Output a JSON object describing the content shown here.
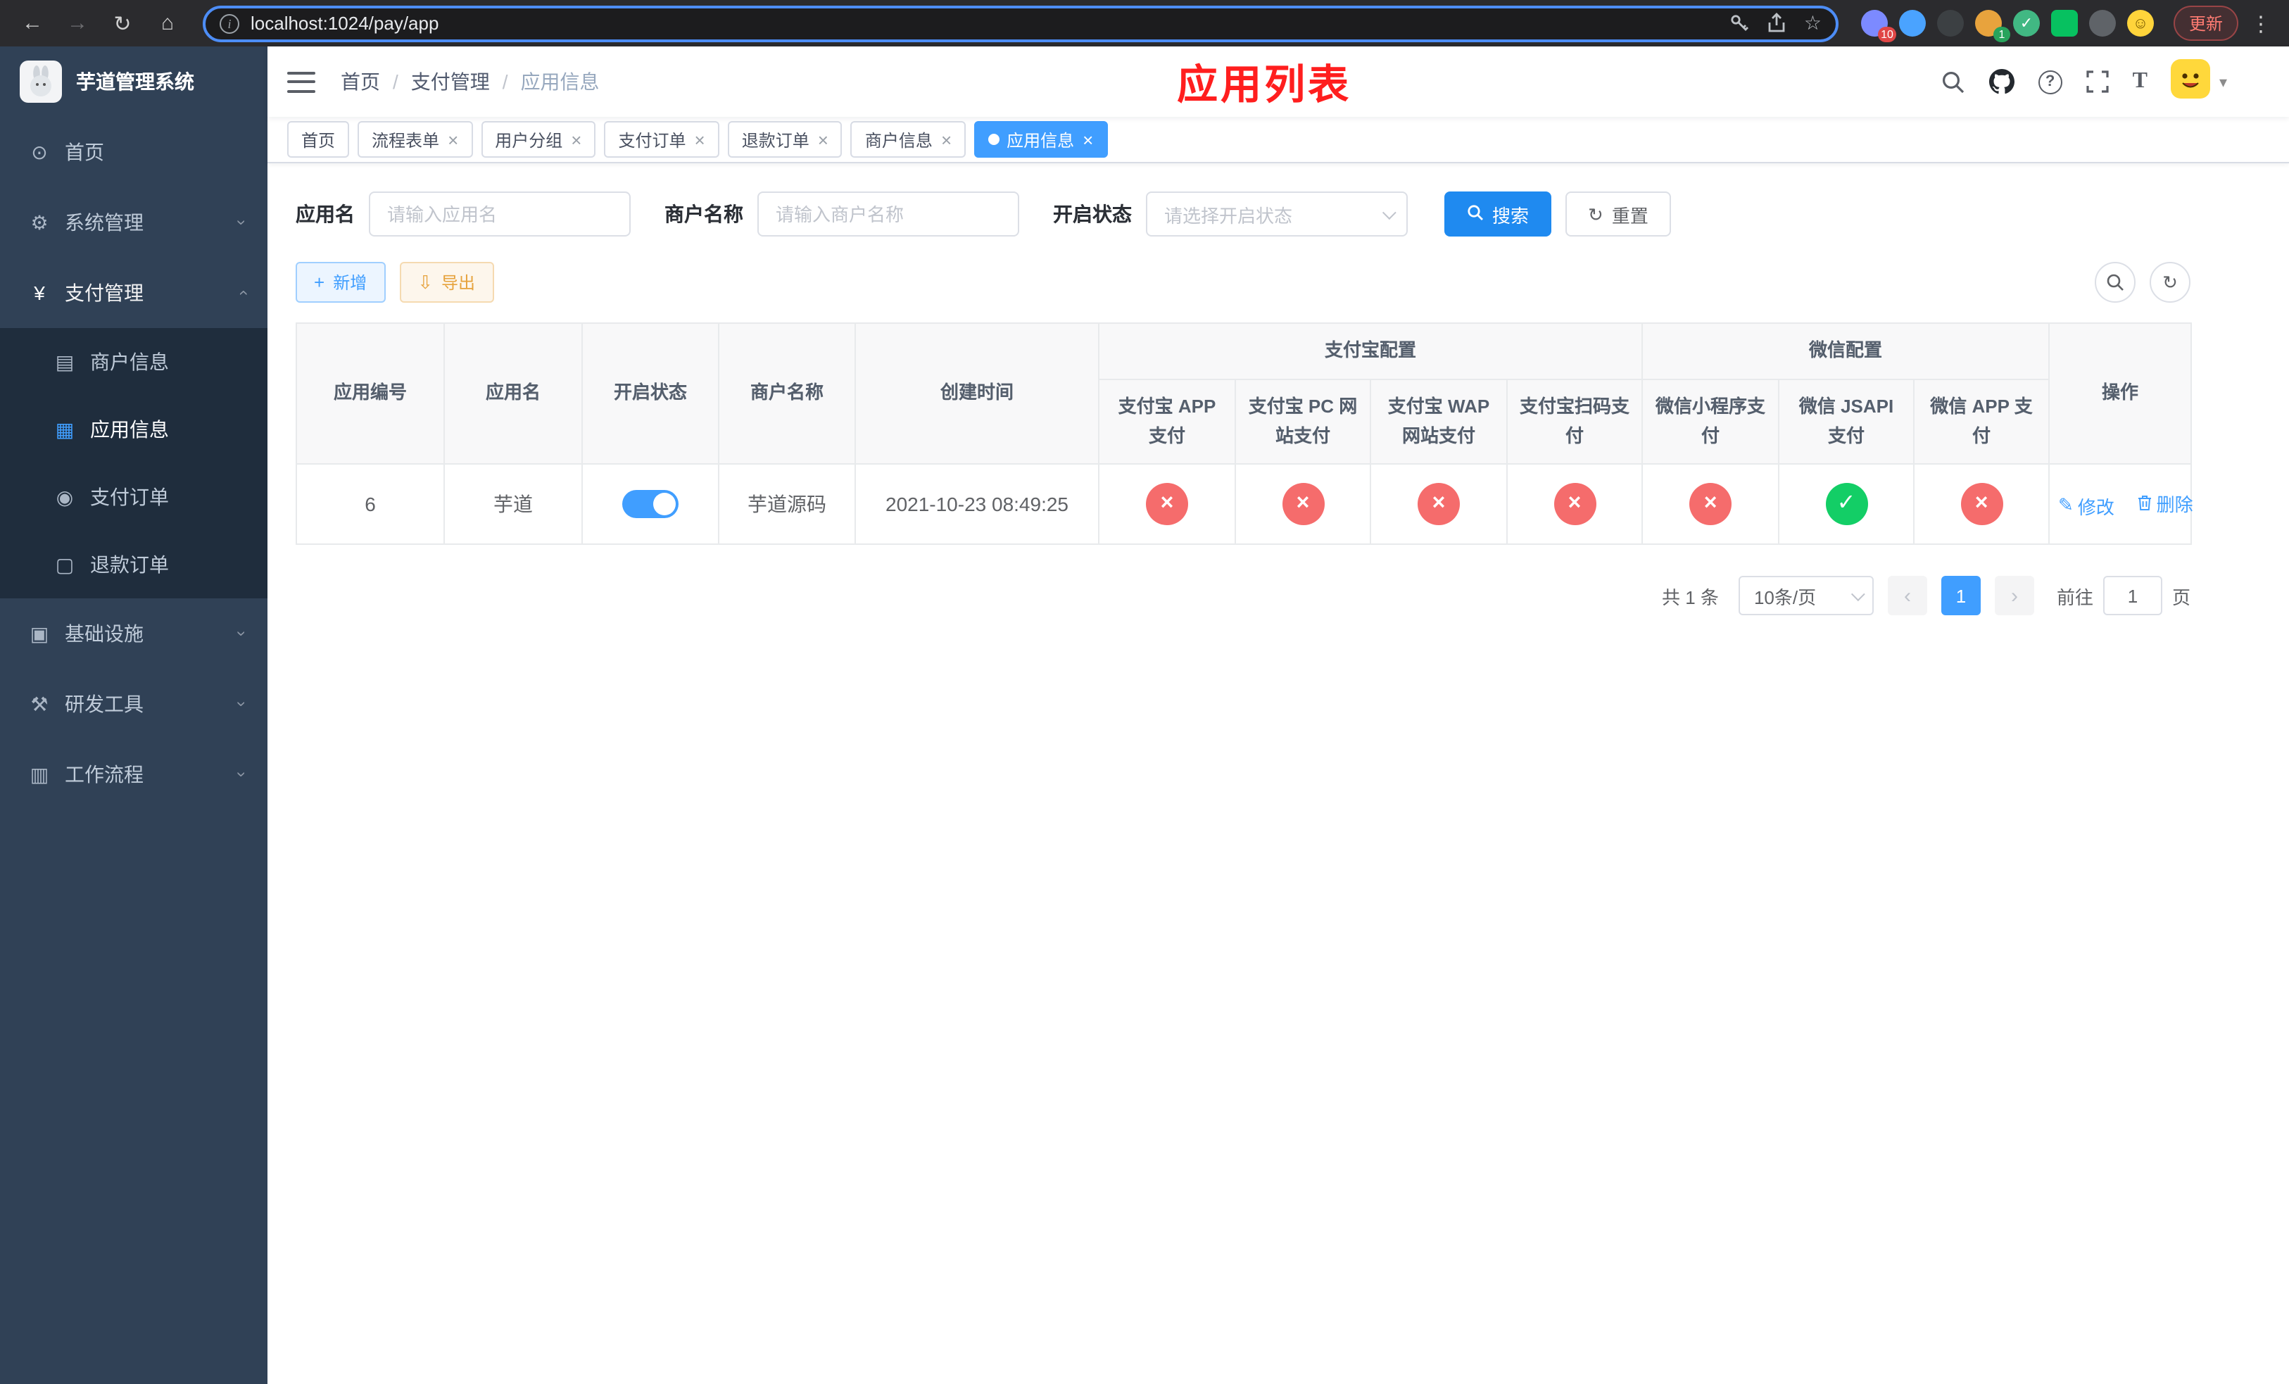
{
  "browser": {
    "url": "localhost:1024/pay/app",
    "update_label": "更新",
    "extension_badge_puzzle": "10",
    "extension_badge_avatar": "1"
  },
  "sidebar": {
    "title": "芋道管理系统",
    "items": [
      {
        "label": "首页"
      },
      {
        "label": "系统管理"
      },
      {
        "label": "支付管理"
      },
      {
        "label": "商户信息"
      },
      {
        "label": "应用信息"
      },
      {
        "label": "支付订单"
      },
      {
        "label": "退款订单"
      },
      {
        "label": "基础设施"
      },
      {
        "label": "研发工具"
      },
      {
        "label": "工作流程"
      }
    ]
  },
  "breadcrumb": [
    "首页",
    "支付管理",
    "应用信息"
  ],
  "header": {
    "page_title": "应用列表"
  },
  "tabs": [
    {
      "label": "首页"
    },
    {
      "label": "流程表单"
    },
    {
      "label": "用户分组"
    },
    {
      "label": "支付订单"
    },
    {
      "label": "退款订单"
    },
    {
      "label": "商户信息"
    },
    {
      "label": "应用信息"
    }
  ],
  "filters": {
    "app_name_label": "应用名",
    "app_name_placeholder": "请输入应用名",
    "merchant_label": "商户名称",
    "merchant_placeholder": "请输入商户名称",
    "status_label": "开启状态",
    "status_placeholder": "请选择开启状态",
    "search_label": "搜索",
    "reset_label": "重置"
  },
  "toolbar": {
    "add_label": "新增",
    "export_label": "导出"
  },
  "table": {
    "main_columns": [
      "应用编号",
      "应用名",
      "开启状态",
      "商户名称",
      "创建时间"
    ],
    "alipay_group": "支付宝配置",
    "wechat_group": "微信配置",
    "ops_column": "操作",
    "sub_columns": [
      "支付宝 APP 支付",
      "支付宝 PC 网站支付",
      "支付宝 WAP 网站支付",
      "支付宝扫码支付",
      "微信小程序支付",
      "微信 JSAPI 支付",
      "微信 APP 支付"
    ],
    "rows": [
      {
        "id": "6",
        "name": "芋道",
        "status_on": true,
        "merchant": "芋道源码",
        "created_at": "2021-10-23 08:49:25",
        "configs": [
          "no",
          "no",
          "no",
          "no",
          "no",
          "yes",
          "no"
        ]
      }
    ],
    "edit_label": "修改",
    "delete_label": "删除"
  },
  "pagination": {
    "total": "共 1 条",
    "page_size": "10条/页",
    "current_page": "1",
    "goto_label": "前往",
    "goto_value": "1",
    "unit_label": "页"
  },
  "colors": {
    "accent": "#409eff",
    "danger": "#f56c6c",
    "success": "#13ce66",
    "warning": "#e6a23c",
    "title_red": "#ff1e1e"
  }
}
